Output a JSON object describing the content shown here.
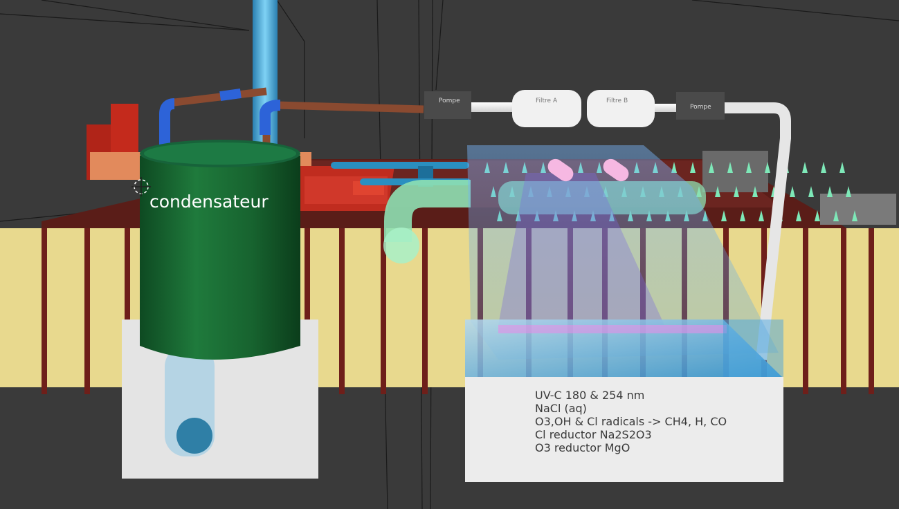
{
  "scene": {
    "condenser_label": "condensateur",
    "pump_left_label": "Pompe",
    "pump_right_label": "Pompe",
    "filter_a_label": "Filtre A",
    "filter_b_label": "Filtre B",
    "reactor_text": [
      "UV-C 180 & 254 nm",
      "NaCl (aq)",
      "O3,OH & Cl radicals -> CH4, H, CO",
      "Cl reductor Na2S2O3",
      "O3 reductor MgO"
    ]
  },
  "colors": {
    "background": "#3a3a3a",
    "fence": "#e8d98e",
    "fence_post": "#6e1f1a",
    "condenser": "#1c6b35",
    "pipe_white": "#e6e6e6",
    "pump": "#4a4a4a",
    "uv_water": "#5aa8d8",
    "plant": "#7ee8b8"
  }
}
